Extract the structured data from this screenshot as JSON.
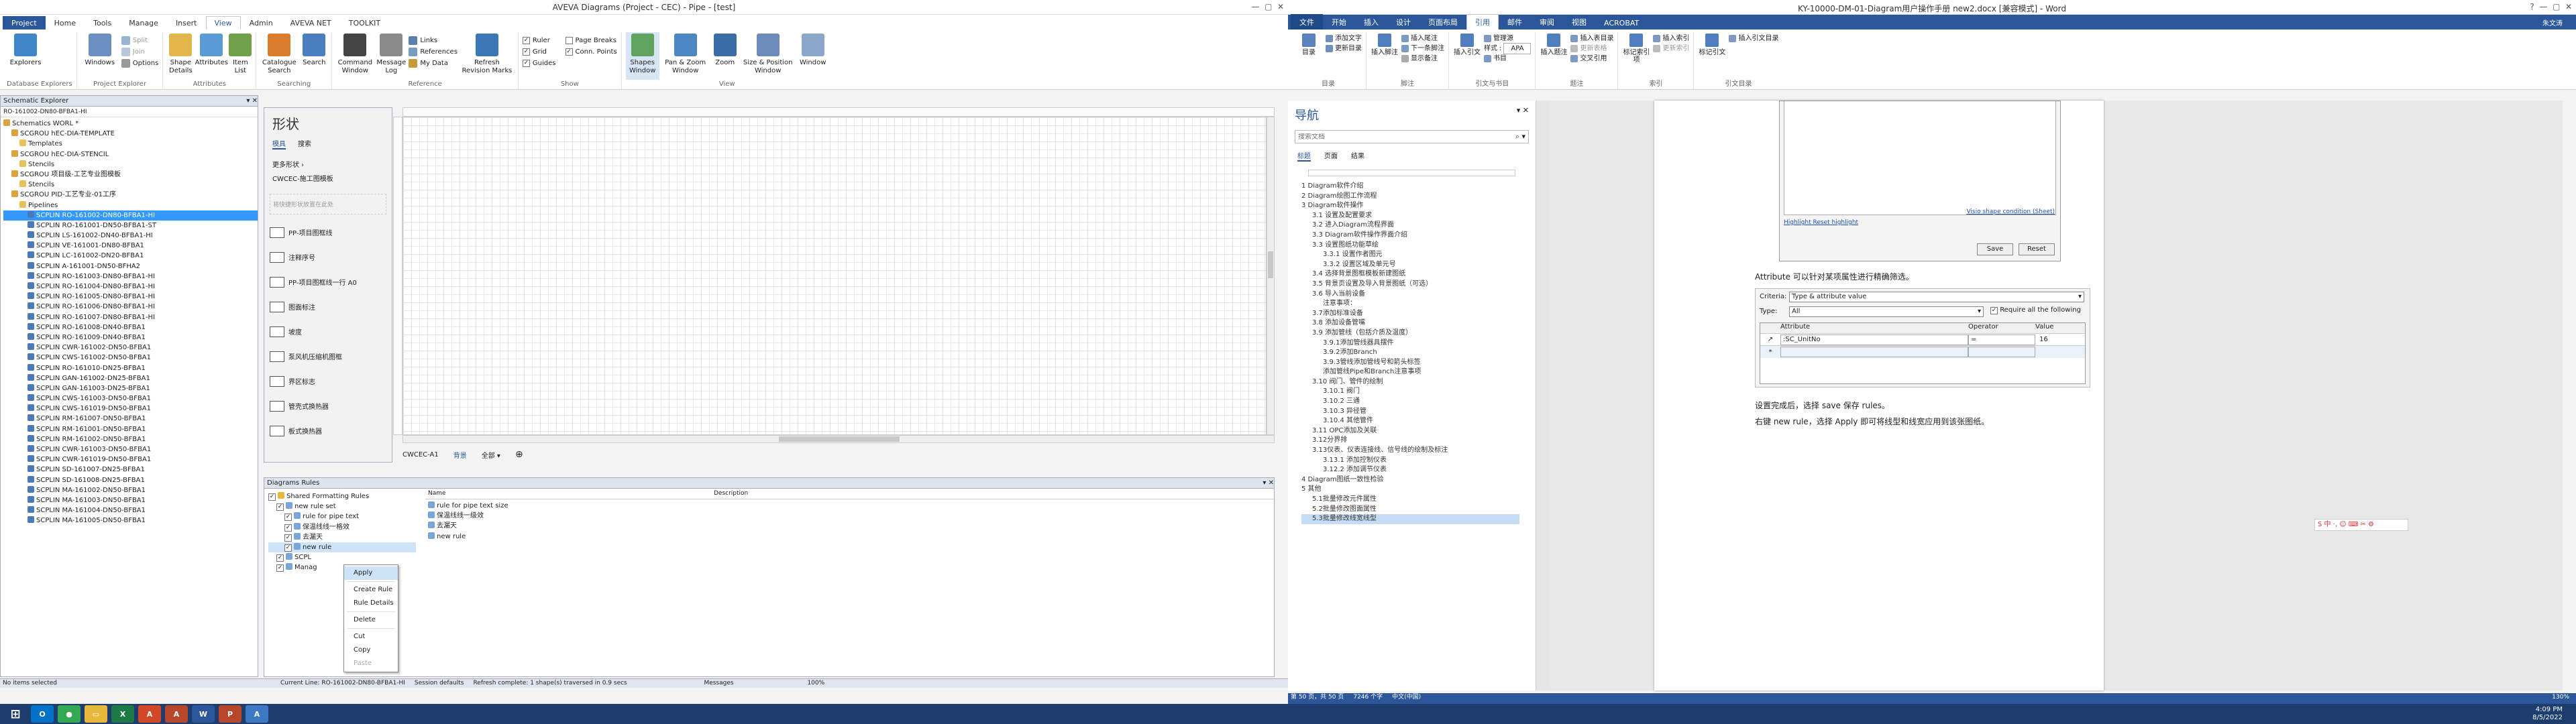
{
  "aveva": {
    "title": "AVEVA Diagrams (Project - CEC) - Pipe - [test]",
    "tabs": [
      "Project",
      "Home",
      "Tools",
      "Manage",
      "Insert",
      "View",
      "Admin",
      "AVEVA NET",
      "TOOLKIT"
    ],
    "active_tab": "View",
    "ribbon": {
      "explorers": "Explorers",
      "windows": "Windows",
      "split": "Split",
      "join": "Join",
      "options": "Options",
      "shape_details": "Shape Details",
      "attributes": "Attributes",
      "item_list": "Item List",
      "catalogue_search": "Catalogue Search",
      "search": "Search",
      "command_window": "Command Window",
      "message_log": "Message Log",
      "links": "Links",
      "references": "References",
      "my_data": "My Data",
      "refresh_revision": "Refresh Revision Marks",
      "ruler": "Ruler",
      "grid": "Grid",
      "guides": "Guides",
      "page_breaks": "Page Breaks",
      "conn_points": "Conn. Points",
      "shapes_window": "Shapes Window",
      "pan_zoom": "Pan & Zoom Window",
      "zoom": "Zoom",
      "size_position": "Size & Position Window",
      "window": "Window",
      "groups": [
        "Database Explorers",
        "Project Explorer",
        "Attributes",
        "Reference",
        "Searching",
        "Show",
        "View"
      ]
    },
    "schematic": {
      "title": "Schematic Explorer",
      "path": "RO-161002-DN80-BFBA1-HI",
      "items": [
        {
          "t": "Schematics WORL *",
          "l": 0
        },
        {
          "t": "SCGROU hEC-DIA-TEMPLATE",
          "l": 1
        },
        {
          "t": "Templates",
          "l": 2
        },
        {
          "t": "SCGROU hEC-DIA-STENCIL",
          "l": 1
        },
        {
          "t": "Stencils",
          "l": 2
        },
        {
          "t": "SCGROU 项目级-工艺专业图模板",
          "l": 1
        },
        {
          "t": "Stencils",
          "l": 2
        },
        {
          "t": "SCGROU PID-工艺专业-01工序",
          "l": 1
        },
        {
          "t": "Pipelines",
          "l": 2
        },
        {
          "t": "SCPLIN RO-161002-DN80-BFBA1-HI",
          "l": 3,
          "sel": true
        },
        {
          "t": "SCPLIN RO-161001-DN50-BFBA1-ST",
          "l": 3
        },
        {
          "t": "SCPLIN LS-161002-DN40-BFBA1-HI",
          "l": 3
        },
        {
          "t": "SCPLIN VE-161001-DN80-BFBA1",
          "l": 3
        },
        {
          "t": "SCPLIN LC-161002-DN20-BFBA1",
          "l": 3
        },
        {
          "t": "SCPLIN A-161001-DN50-BFHA2",
          "l": 3
        },
        {
          "t": "SCPLIN RO-161003-DN80-BFBA1-HI",
          "l": 3
        },
        {
          "t": "SCPLIN RO-161004-DN80-BFBA1-HI",
          "l": 3
        },
        {
          "t": "SCPLIN RO-161005-DN80-BFBA1-HI",
          "l": 3
        },
        {
          "t": "SCPLIN RO-161006-DN80-BFBA1-HI",
          "l": 3
        },
        {
          "t": "SCPLIN RO-161007-DN80-BFBA1-HI",
          "l": 3
        },
        {
          "t": "SCPLIN RO-161008-DN40-BFBA1",
          "l": 3
        },
        {
          "t": "SCPLIN RO-161009-DN40-BFBA1",
          "l": 3
        },
        {
          "t": "SCPLIN CWR-161002-DN50-BFBA1",
          "l": 3
        },
        {
          "t": "SCPLIN CWS-161002-DN50-BFBA1",
          "l": 3
        },
        {
          "t": "SCPLIN RO-161010-DN25-BFBA1",
          "l": 3
        },
        {
          "t": "SCPLIN GAN-161002-DN25-BFBA1",
          "l": 3
        },
        {
          "t": "SCPLIN GAN-161003-DN25-BFBA1",
          "l": 3
        },
        {
          "t": "SCPLIN CWS-161003-DN50-BFBA1",
          "l": 3
        },
        {
          "t": "SCPLIN CWS-161019-DN50-BFBA1",
          "l": 3
        },
        {
          "t": "SCPLIN RM-161007-DN50-BFBA1",
          "l": 3
        },
        {
          "t": "SCPLIN RM-161001-DN50-BFBA1",
          "l": 3
        },
        {
          "t": "SCPLIN RM-161002-DN50-BFBA1",
          "l": 3
        },
        {
          "t": "SCPLIN CWR-161003-DN50-BFBA1",
          "l": 3
        },
        {
          "t": "SCPLIN CWR-161019-DN50-BFBA1",
          "l": 3
        },
        {
          "t": "SCPLIN SD-161007-DN25-BFBA1",
          "l": 3
        },
        {
          "t": "SCPLIN SD-161008-DN25-BFBA1",
          "l": 3
        },
        {
          "t": "SCPLIN MA-161002-DN50-BFBA1",
          "l": 3
        },
        {
          "t": "SCPLIN MA-161003-DN50-BFBA1",
          "l": 3
        },
        {
          "t": "SCPLIN MA-161004-DN50-BFBA1",
          "l": 3
        },
        {
          "t": "SCPLIN MA-161005-DN50-BFBA1",
          "l": 3
        }
      ]
    },
    "shapes": {
      "title": "形状",
      "tab_models": "模具",
      "tab_search": "搜索",
      "more_shapes": "更多形状",
      "quick": "CWCEC-施工图模板",
      "hint": "将快捷形状放置在此处",
      "items": [
        "PP-项目图框线",
        "注释序号",
        "PP-项目图框线一行 A0",
        "图面标注",
        "坡度",
        "泵风机压缩机图框",
        "界区标志",
        "管壳式换热器",
        "板式换热器"
      ]
    },
    "canvas": {
      "page_tab": "CWCEC-A1",
      "bg_tab": "背景",
      "all_tab": "全部"
    },
    "rules": {
      "title": "Diagrams Rules",
      "tree": [
        {
          "t": "Shared Formatting Rules",
          "l": 0
        },
        {
          "t": "new rule set",
          "l": 1
        },
        {
          "t": "rule for pipe text",
          "l": 2
        },
        {
          "t": "保温线线一格效",
          "l": 2
        },
        {
          "t": "去漏天",
          "l": 2
        },
        {
          "t": "new rule",
          "l": 2,
          "sel": true
        },
        {
          "t": "SCPL",
          "l": 1
        },
        {
          "t": "Manag",
          "l": 1
        }
      ],
      "col_name": "Name",
      "col_desc": "Description",
      "list": [
        "rule for pipe text size",
        "保温线线一级效",
        "去漏天",
        "new rule"
      ]
    },
    "context_menu": [
      "Apply",
      "Create Rule",
      "Rule Details",
      "Delete",
      "Cut",
      "Copy",
      "Paste"
    ],
    "status": {
      "left": "No items selected",
      "current": "Current Line: RO-161002-DN80-BFBA1-HI",
      "session": "Session defaults",
      "refresh": "Refresh complete: 1 shape(s) traversed in 0.9 secs",
      "messages": "Messages",
      "zoom": "100%"
    }
  },
  "word": {
    "title": "KY-10000-DM-01-Diagram用户操作手册 new2.docx [兼容模式] - Word",
    "user": "朱文涛",
    "tabs": [
      "文件",
      "开始",
      "插入",
      "设计",
      "页面布局",
      "引用",
      "邮件",
      "审阅",
      "视图",
      "ACROBAT"
    ],
    "active_tab": "引用",
    "ribbon_groups": [
      "目录",
      "脚注",
      "引文与书目",
      "题注",
      "索引",
      "引文目录"
    ],
    "ribbon_buttons": [
      "目录",
      "添加文字",
      "更新目录",
      "插入脚注",
      "插入尾注",
      "下一条脚注",
      "显示备注",
      "插入引文",
      "管理源",
      "样式",
      "书目",
      "插入题注",
      "插入表目录",
      "更新表格",
      "交叉引用",
      "标记索引项",
      "插入索引",
      "更新索引",
      "标记引文",
      "插入引文目录"
    ],
    "style_value": "APA",
    "nav": {
      "title": "导航",
      "search_placeholder": "搜索文档",
      "tabs": [
        "标题",
        "页面",
        "结果"
      ],
      "items": [
        {
          "t": "1 Diagram软件介绍",
          "l": 0
        },
        {
          "t": "2 Diagram绘图工作流程",
          "l": 0
        },
        {
          "t": "3 Diagram软件操作",
          "l": 0
        },
        {
          "t": "3.1 设置及配置要求",
          "l": 1
        },
        {
          "t": "3.2 进入Diagram流程界面",
          "l": 1
        },
        {
          "t": "3.3 Diagram软件操作界面介绍",
          "l": 1
        },
        {
          "t": "3.3 设置图纸功能草绘",
          "l": 1
        },
        {
          "t": "3.3.1 设置作者图元",
          "l": 2
        },
        {
          "t": "3.3.2 设置区域及单元号",
          "l": 2
        },
        {
          "t": "3.4 选择背景图框模板新建图纸",
          "l": 1
        },
        {
          "t": "3.5 背景页设置及导入背景图纸（可选）",
          "l": 1
        },
        {
          "t": "3.6 导入当前设备",
          "l": 1
        },
        {
          "t": "注意事项：",
          "l": 2
        },
        {
          "t": "3.7添加标准设备",
          "l": 1
        },
        {
          "t": "3.8 添加设备管嘴",
          "l": 1
        },
        {
          "t": "3.9 添加管线（包括介质及温度）",
          "l": 1
        },
        {
          "t": "3.9.1添加管线器具摆件",
          "l": 2
        },
        {
          "t": "3.9.2添加Branch",
          "l": 2
        },
        {
          "t": "3.9.3管线添加管线号和箭头标签",
          "l": 2
        },
        {
          "t": "添加管线Pipe和Branch注意事项",
          "l": 2
        },
        {
          "t": "3.10 阀门、管件的绘制",
          "l": 1
        },
        {
          "t": "3.10.1 阀门",
          "l": 2
        },
        {
          "t": "3.10.2 三通",
          "l": 2
        },
        {
          "t": "3.10.3 异径管",
          "l": 2
        },
        {
          "t": "3.10.4 其他管件",
          "l": 2
        },
        {
          "t": "3.11 OPC添加及关联",
          "l": 1
        },
        {
          "t": "3.12分界排",
          "l": 1
        },
        {
          "t": "3.13仪表、仪表连接线、信号线的绘制及标注",
          "l": 1
        },
        {
          "t": "3.13.1 添加控制仪表",
          "l": 2
        },
        {
          "t": "3.12.2 添加调节仪表",
          "l": 2
        },
        {
          "t": "4 Diagram图纸一致性检验",
          "l": 0
        },
        {
          "t": "5 其他",
          "l": 0
        },
        {
          "t": "5.1批量修改元件属性",
          "l": 1
        },
        {
          "t": "5.2批量修改图面属性",
          "l": 1
        },
        {
          "t": "5.3批量修改线宽线型",
          "l": 1,
          "sel": true
        }
      ]
    },
    "doc": {
      "highlight_link": "Highlight Reset highlight",
      "visio_link": "Visio shape condition (Sheet)",
      "save_btn": "Save",
      "reset_btn": "Reset",
      "para1": "Attribute 可以针对某项属性进行精确筛选。",
      "criteria_label": "Criteria:",
      "criteria_value": "Type & attribute value",
      "type_label": "Type:",
      "type_value": "All",
      "require_label": "Require all the following",
      "grid_headers": [
        "Attribute",
        "Operator",
        "Value"
      ],
      "grid_row": {
        "attr": ":SC_UnitNo",
        "op": "=",
        "val": "16"
      },
      "para2": "设置完成后，选择 save 保存 rules。",
      "para3": "右键 new rule，选择 Apply 即可将线型和线宽应用到该张图纸。"
    },
    "status": {
      "page": "第 50 页，共 50 页",
      "words": "7246 个字",
      "lang": "中文(中国)",
      "zoom": "130%"
    }
  },
  "taskbar": {
    "time": "4:09 PM",
    "date": "8/5/2022"
  }
}
